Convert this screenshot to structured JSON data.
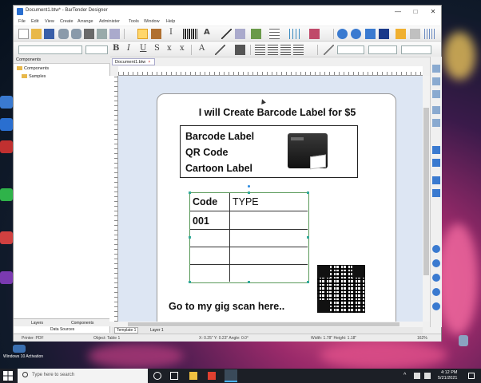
{
  "window": {
    "title": "Document1.btw* - BarTender Designer",
    "minimize": "—",
    "maximize": "□",
    "close": "✕"
  },
  "menu": [
    "File",
    "Edit",
    "View",
    "Create",
    "Arrange",
    "Administer",
    "Tools",
    "Window",
    "Help"
  ],
  "panel": {
    "header": "Components",
    "tree_root": "Components",
    "tree_child": "Samples",
    "tab_layers": "Layers",
    "tab_components": "Components",
    "tab_data_sources": "Data Sources"
  },
  "document_tab": "Document1.btw",
  "label": {
    "headline": "I will Create Barcode Label for $5",
    "items": [
      "Barcode Label",
      "QR Code",
      "Cartoon Label"
    ],
    "table_headers": [
      "Code",
      "TYPE"
    ],
    "table_first_cell": "001",
    "footer": "Go to my gig scan here.."
  },
  "page_tabs": [
    "Template 1",
    "Layer 1"
  ],
  "status": {
    "printer": "Printer: PDF",
    "object": "Object: Table 1",
    "position": "X: 0.25\"  Y: 0.23\"  Angle: 0.0°",
    "size": "Width: 1.78\"  Height: 1.18\"",
    "zoom": "162%"
  },
  "desktop": {
    "icon_label": "Windows 10 Activation"
  },
  "taskbar": {
    "search_placeholder": "Type here to search",
    "time": "4:12 PM",
    "date": "5/21/2021"
  }
}
